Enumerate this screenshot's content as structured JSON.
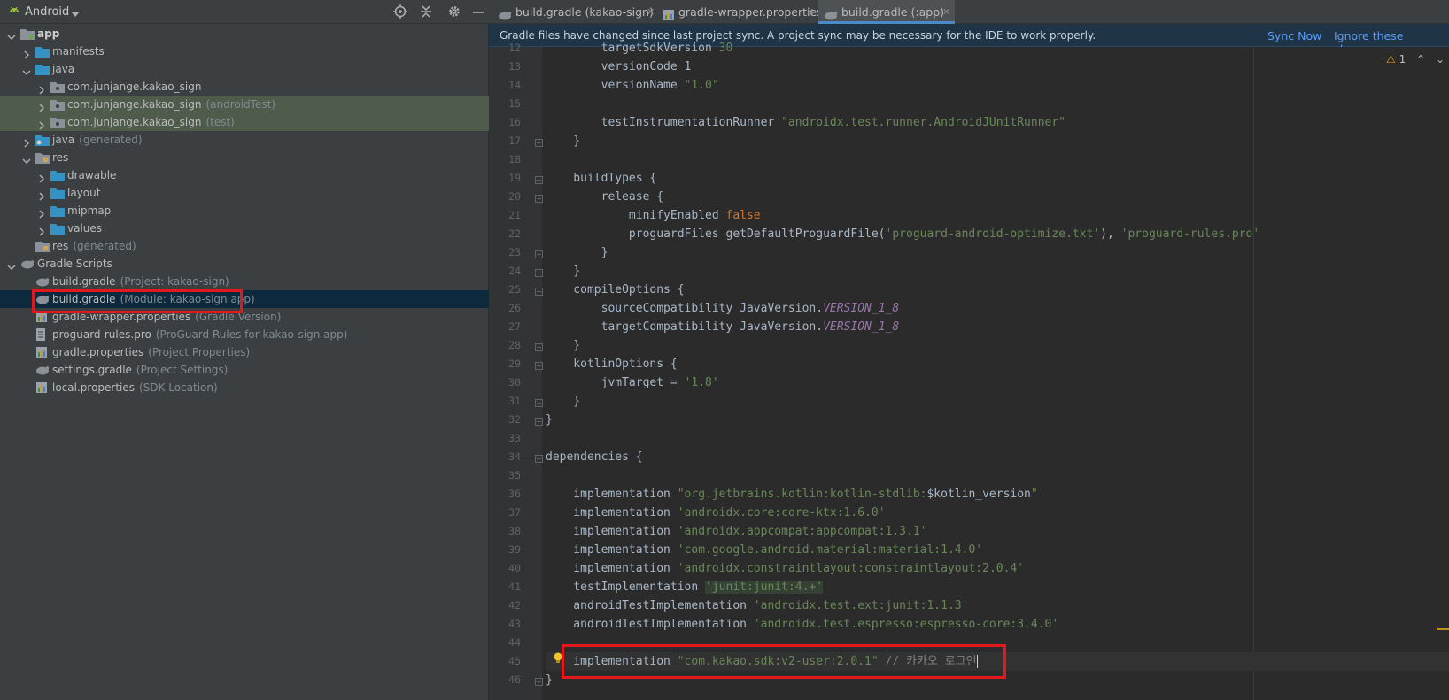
{
  "project": {
    "view_label": "Android",
    "tree": [
      {
        "label": "app",
        "hint": "",
        "depth": 0,
        "expanded": true,
        "bold": true,
        "icon": "module-folder-icon"
      },
      {
        "label": "manifests",
        "hint": "",
        "depth": 1,
        "expanded": false,
        "icon": "folder-icon"
      },
      {
        "label": "java",
        "hint": "",
        "depth": 1,
        "expanded": true,
        "icon": "folder-icon"
      },
      {
        "label": "com.junjange.kakao_sign",
        "hint": "",
        "depth": 2,
        "expanded": false,
        "icon": "package-icon"
      },
      {
        "label": "com.junjange.kakao_sign",
        "hint": "(androidTest)",
        "depth": 2,
        "expanded": false,
        "icon": "package-icon",
        "mod": true
      },
      {
        "label": "com.junjange.kakao_sign",
        "hint": "(test)",
        "depth": 2,
        "expanded": false,
        "icon": "package-icon",
        "mod": true
      },
      {
        "label": "java",
        "hint": "(generated)",
        "depth": 1,
        "expanded": false,
        "icon": "generated-folder-icon"
      },
      {
        "label": "res",
        "hint": "",
        "depth": 1,
        "expanded": true,
        "icon": "res-folder-icon"
      },
      {
        "label": "drawable",
        "hint": "",
        "depth": 2,
        "expanded": false,
        "icon": "folder-icon"
      },
      {
        "label": "layout",
        "hint": "",
        "depth": 2,
        "expanded": false,
        "icon": "folder-icon"
      },
      {
        "label": "mipmap",
        "hint": "",
        "depth": 2,
        "expanded": false,
        "icon": "folder-icon"
      },
      {
        "label": "values",
        "hint": "",
        "depth": 2,
        "expanded": false,
        "icon": "folder-icon"
      },
      {
        "label": "res",
        "hint": "(generated)",
        "depth": 1,
        "expanded": null,
        "icon": "res-folder-icon"
      },
      {
        "label": "Gradle Scripts",
        "hint": "",
        "depth": 0,
        "expanded": true,
        "icon": "gradle-icon"
      },
      {
        "label": "build.gradle",
        "hint": "(Project: kakao-sign)",
        "depth": 1,
        "expanded": null,
        "icon": "gradle-icon"
      },
      {
        "label": "build.gradle",
        "hint": "(Module: kakao-sign.app)",
        "depth": 1,
        "expanded": null,
        "icon": "gradle-icon",
        "selected": true
      },
      {
        "label": "gradle-wrapper.properties",
        "hint": "(Gradle Version)",
        "depth": 1,
        "expanded": null,
        "icon": "properties-icon"
      },
      {
        "label": "proguard-rules.pro",
        "hint": "(ProGuard Rules for kakao-sign.app)",
        "depth": 1,
        "expanded": null,
        "icon": "text-file-icon"
      },
      {
        "label": "gradle.properties",
        "hint": "(Project Properties)",
        "depth": 1,
        "expanded": null,
        "icon": "properties-icon"
      },
      {
        "label": "settings.gradle",
        "hint": "(Project Settings)",
        "depth": 1,
        "expanded": null,
        "icon": "gradle-icon"
      },
      {
        "label": "local.properties",
        "hint": "(SDK Location)",
        "depth": 1,
        "expanded": null,
        "icon": "properties-icon"
      }
    ]
  },
  "tabs": [
    {
      "label": "build.gradle (kakao-sign)",
      "icon": "gradle-icon",
      "active": false
    },
    {
      "label": "gradle-wrapper.properties",
      "icon": "properties-icon",
      "active": false
    },
    {
      "label": "build.gradle (:app)",
      "icon": "gradle-icon",
      "active": true
    }
  ],
  "banner": {
    "message": "Gradle files have changed since last project sync. A project sync may be necessary for the IDE to work properly.",
    "sync_now": "Sync Now",
    "ignore": "Ignore these changes"
  },
  "inspection": {
    "warnings": "1",
    "warning_icon": "warning-icon"
  },
  "editor": {
    "lines": [
      {
        "n": "12",
        "segs": [
          [
            "        targetSdkVersion ",
            ""
          ],
          [
            "30",
            "str"
          ]
        ]
      },
      {
        "n": "13",
        "segs": [
          [
            "        versionCode ",
            ""
          ],
          [
            "1",
            ""
          ]
        ]
      },
      {
        "n": "14",
        "segs": [
          [
            "        versionName ",
            ""
          ],
          [
            "\"1.0\"",
            "str"
          ]
        ]
      },
      {
        "n": "15",
        "segs": []
      },
      {
        "n": "16",
        "segs": [
          [
            "        testInstrumentationRunner ",
            ""
          ],
          [
            "\"androidx.test.runner.AndroidJUnitRunner\"",
            "str"
          ]
        ]
      },
      {
        "n": "17",
        "segs": [
          [
            "    }",
            ""
          ]
        ],
        "fold": true
      },
      {
        "n": "18",
        "segs": []
      },
      {
        "n": "19",
        "segs": [
          [
            "    buildTypes {",
            ""
          ]
        ],
        "fold": true
      },
      {
        "n": "20",
        "segs": [
          [
            "        release {",
            ""
          ]
        ],
        "fold": true
      },
      {
        "n": "21",
        "segs": [
          [
            "            minifyEnabled ",
            ""
          ],
          [
            "false",
            "kw"
          ]
        ]
      },
      {
        "n": "22",
        "segs": [
          [
            "            proguardFiles getDefaultProguardFile(",
            ""
          ],
          [
            "'proguard-android-optimize.txt'",
            "str"
          ],
          [
            "), ",
            ""
          ],
          [
            "'proguard-rules.pro'",
            "str"
          ]
        ]
      },
      {
        "n": "23",
        "segs": [
          [
            "        }",
            ""
          ]
        ],
        "fold": true
      },
      {
        "n": "24",
        "segs": [
          [
            "    }",
            ""
          ]
        ],
        "fold": true
      },
      {
        "n": "25",
        "segs": [
          [
            "    compileOptions {",
            ""
          ]
        ],
        "fold": true
      },
      {
        "n": "26",
        "segs": [
          [
            "        sourceCompatibility JavaVersion.",
            ""
          ],
          [
            "VERSION_1_8",
            "ital"
          ]
        ]
      },
      {
        "n": "27",
        "segs": [
          [
            "        targetCompatibility JavaVersion.",
            ""
          ],
          [
            "VERSION_1_8",
            "ital"
          ]
        ]
      },
      {
        "n": "28",
        "segs": [
          [
            "    }",
            ""
          ]
        ],
        "fold": true
      },
      {
        "n": "29",
        "segs": [
          [
            "    kotlinOptions {",
            ""
          ]
        ],
        "fold": true
      },
      {
        "n": "30",
        "segs": [
          [
            "        jvmTarget = ",
            ""
          ],
          [
            "'1.8'",
            "str"
          ]
        ]
      },
      {
        "n": "31",
        "segs": [
          [
            "    }",
            ""
          ]
        ],
        "fold": true
      },
      {
        "n": "32",
        "segs": [
          [
            "}",
            ""
          ]
        ],
        "fold": true
      },
      {
        "n": "33",
        "segs": []
      },
      {
        "n": "34",
        "segs": [
          [
            "dependencies {",
            ""
          ]
        ],
        "fold": true
      },
      {
        "n": "35",
        "segs": []
      },
      {
        "n": "36",
        "segs": [
          [
            "    implementation ",
            ""
          ],
          [
            "\"org.jetbrains.kotlin:kotlin-stdlib:",
            "str"
          ],
          [
            "$kotlin_version",
            ""
          ],
          [
            "\"",
            "str"
          ]
        ]
      },
      {
        "n": "37",
        "segs": [
          [
            "    implementation ",
            ""
          ],
          [
            "'androidx.core:core-ktx:1.6.0'",
            "str"
          ]
        ]
      },
      {
        "n": "38",
        "segs": [
          [
            "    implementation ",
            ""
          ],
          [
            "'androidx.appcompat:appcompat:1.3.1'",
            "str"
          ]
        ]
      },
      {
        "n": "39",
        "segs": [
          [
            "    implementation ",
            ""
          ],
          [
            "'com.google.android.material:material:1.4.0'",
            "str"
          ]
        ]
      },
      {
        "n": "40",
        "segs": [
          [
            "    implementation ",
            ""
          ],
          [
            "'androidx.constraintlayout:constraintlayout:2.0.4'",
            "str"
          ]
        ]
      },
      {
        "n": "41",
        "segs": [
          [
            "    testImplementation ",
            ""
          ],
          [
            "'junit:junit:4.+'",
            "str hl"
          ]
        ]
      },
      {
        "n": "42",
        "segs": [
          [
            "    androidTestImplementation ",
            ""
          ],
          [
            "'androidx.test.ext:junit:1.1.3'",
            "str"
          ]
        ]
      },
      {
        "n": "43",
        "segs": [
          [
            "    androidTestImplementation ",
            ""
          ],
          [
            "'androidx.test.espresso:espresso-core:3.4.0'",
            "str"
          ]
        ]
      },
      {
        "n": "44",
        "segs": []
      },
      {
        "n": "45",
        "segs": [
          [
            "    implementation ",
            ""
          ],
          [
            "\"com.kakao.sdk:v2-user:2.0.1\"",
            "str"
          ],
          [
            " // 카카오 로그인",
            "cmt"
          ]
        ],
        "current": true
      },
      {
        "n": "46",
        "segs": [
          [
            "}",
            ""
          ]
        ],
        "fold": true
      }
    ]
  }
}
